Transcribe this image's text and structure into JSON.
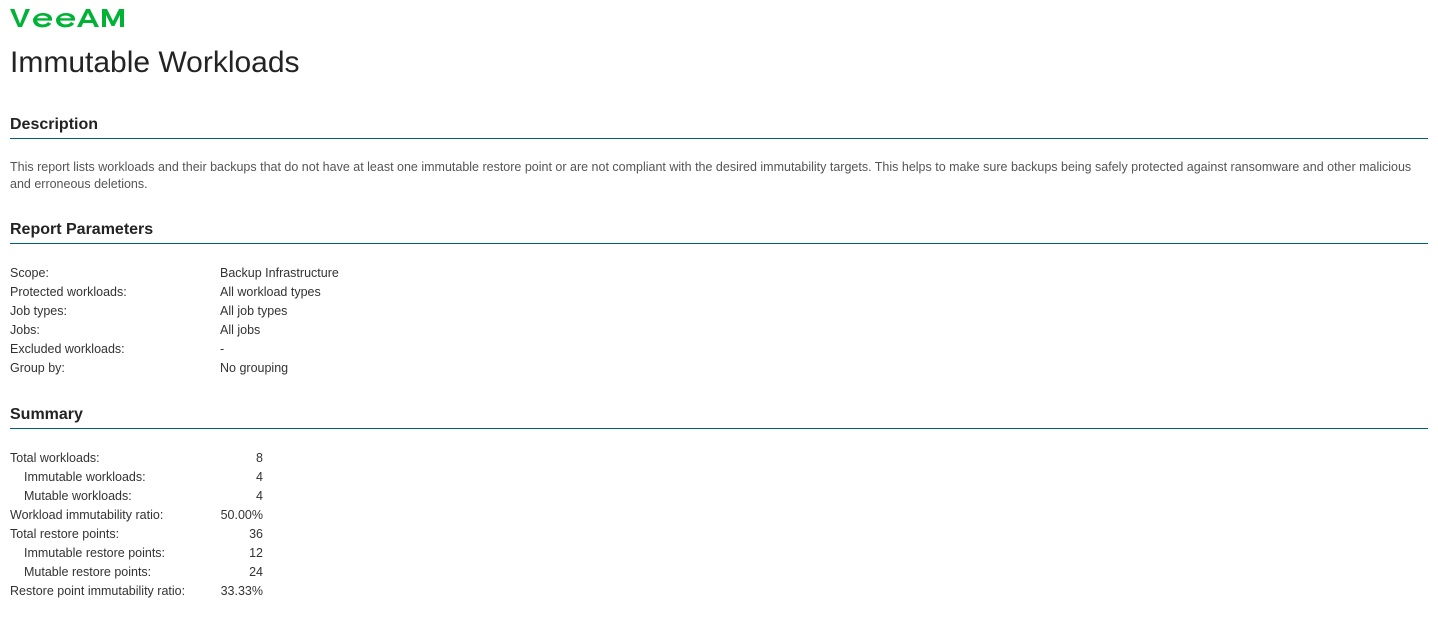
{
  "brand": "veeam",
  "page_title": "Immutable Workloads",
  "sections": {
    "description": {
      "heading": "Description",
      "text": "This report lists workloads and their backups that do not have at least one immutable restore point or are not compliant with the desired immutability targets. This helps to make sure backups being safely protected against ransomware and other malicious and erroneous deletions."
    },
    "parameters": {
      "heading": "Report Parameters",
      "rows": [
        {
          "label": "Scope:",
          "value": "Backup Infrastructure"
        },
        {
          "label": "Protected workloads:",
          "value": "All workload types"
        },
        {
          "label": "Job types:",
          "value": "All job types"
        },
        {
          "label": "Jobs:",
          "value": "All jobs"
        },
        {
          "label": "Excluded workloads:",
          "value": "-"
        },
        {
          "label": "Group by:",
          "value": "No grouping"
        }
      ]
    },
    "summary": {
      "heading": "Summary",
      "rows": [
        {
          "label": "Total workloads:",
          "value": "8",
          "indent": false
        },
        {
          "label": "Immutable workloads:",
          "value": "4",
          "indent": true
        },
        {
          "label": "Mutable workloads:",
          "value": "4",
          "indent": true
        },
        {
          "label": "Workload immutability ratio:",
          "value": "50.00%",
          "indent": false
        },
        {
          "label": "Total restore points:",
          "value": "36",
          "indent": false
        },
        {
          "label": "Immutable restore points:",
          "value": "12",
          "indent": true
        },
        {
          "label": "Mutable restore points:",
          "value": "24",
          "indent": true
        },
        {
          "label": "Restore point immutability ratio:",
          "value": "33.33%",
          "indent": false
        }
      ]
    }
  }
}
